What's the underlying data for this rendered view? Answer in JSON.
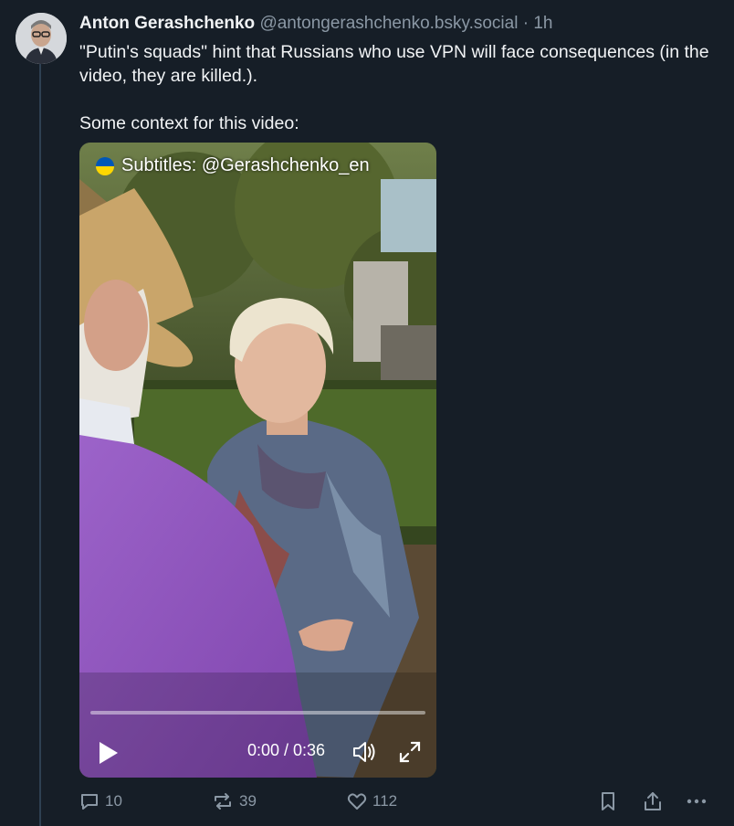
{
  "post": {
    "author_name": "Anton Gerashchenko",
    "handle": "@antongerashchenko.bsky.social",
    "separator": "·",
    "time": "1h",
    "text_line1": "\"Putin's squads\" hint that Russians who use VPN will face consequences (in the video, they are killed.).",
    "text_line2": "Some context for this video:"
  },
  "video": {
    "subtitle": "Subtitles: @Gerashchenko_en",
    "time_display": "0:00 / 0:36",
    "progress": 0.0
  },
  "actions": {
    "replies": "10",
    "reposts": "39",
    "likes": "112"
  },
  "colors": {
    "background": "#161e27",
    "muted_text": "#8b98a5",
    "thread_line": "#2e4052"
  },
  "icons": [
    "avatar",
    "play-icon",
    "volume-icon",
    "fullscreen-icon",
    "reply-icon",
    "repost-icon",
    "like-icon",
    "bookmark-icon",
    "share-icon",
    "more-icon",
    "ukraine-flag-icon"
  ]
}
